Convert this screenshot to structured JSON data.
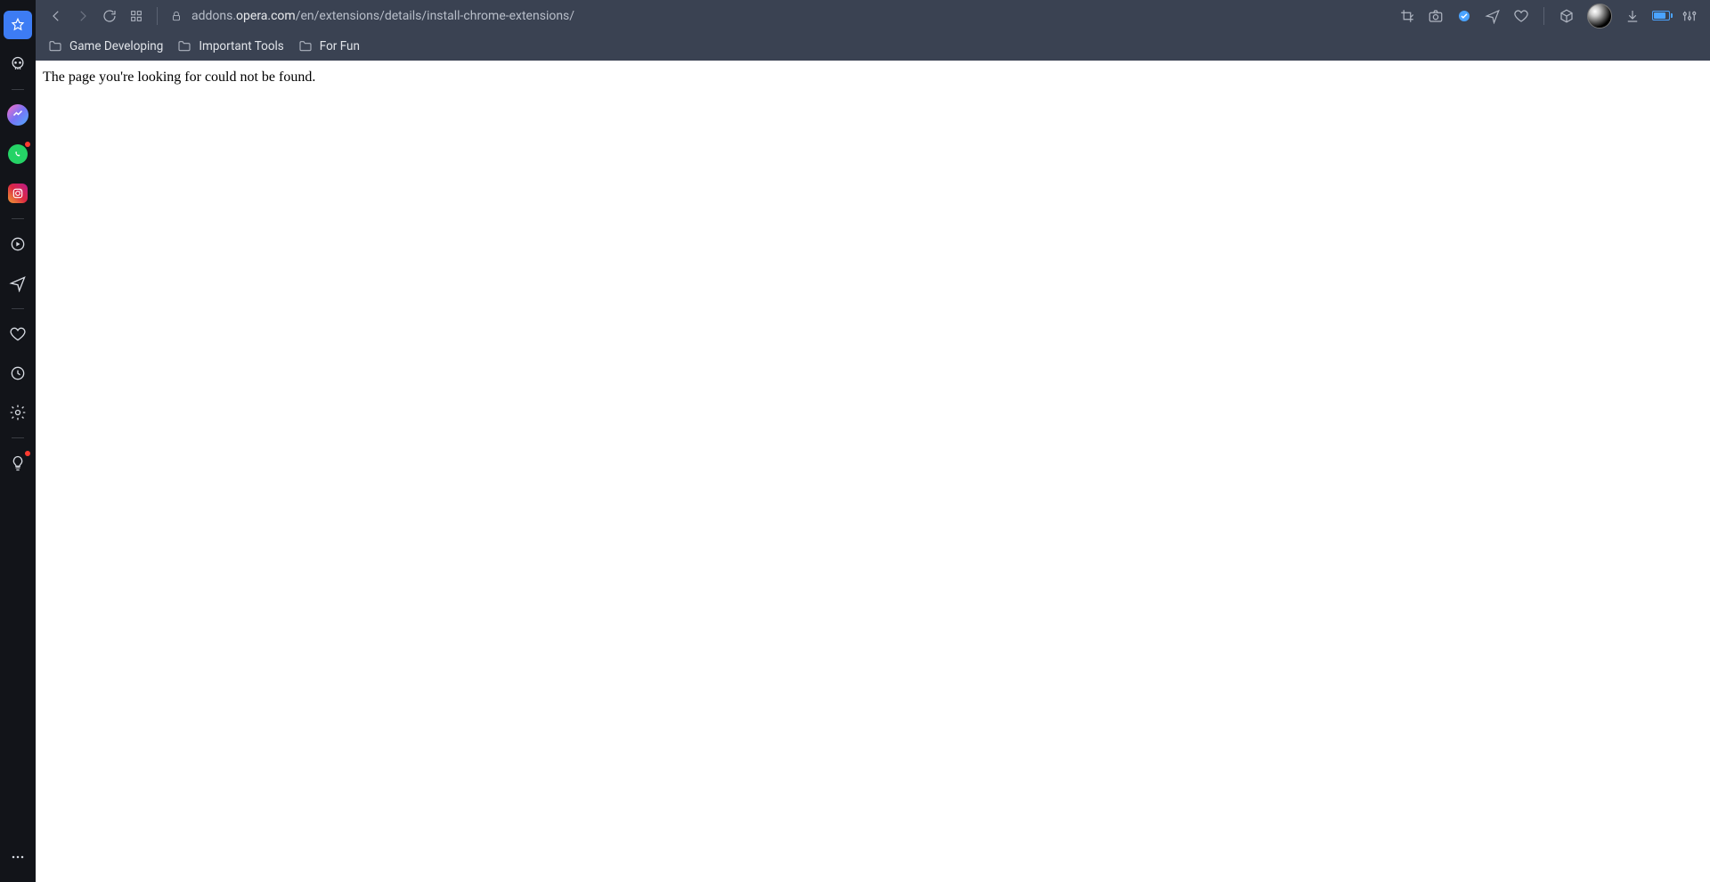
{
  "url": {
    "prefix": "addons.",
    "host": "opera.com",
    "path": "/en/extensions/details/install-chrome-extensions/"
  },
  "bookmarks": [
    {
      "label": "Game Developing"
    },
    {
      "label": "Important Tools"
    },
    {
      "label": "For Fun"
    }
  ],
  "page": {
    "not_found_message": "The page you're looking for could not be found."
  },
  "sidebar_icons": {
    "speed_dial": "speed-dial",
    "skull": "skull",
    "messenger": "messenger",
    "whatsapp": "whatsapp",
    "instagram": "instagram",
    "player": "player",
    "send": "send",
    "heart": "heart",
    "history": "history",
    "settings": "settings",
    "bulb": "bulb",
    "more": "more"
  },
  "toolbar_icons": {
    "back": "back",
    "forward": "forward",
    "reload": "reload",
    "tabs": "tabs",
    "lock": "lock",
    "crop": "crop",
    "snapshot": "snapshot",
    "shield": "shield",
    "send": "send",
    "heart": "heart",
    "cube": "cube",
    "avatar": "avatar",
    "download": "download",
    "battery": "battery",
    "easy_setup": "easy-setup"
  }
}
